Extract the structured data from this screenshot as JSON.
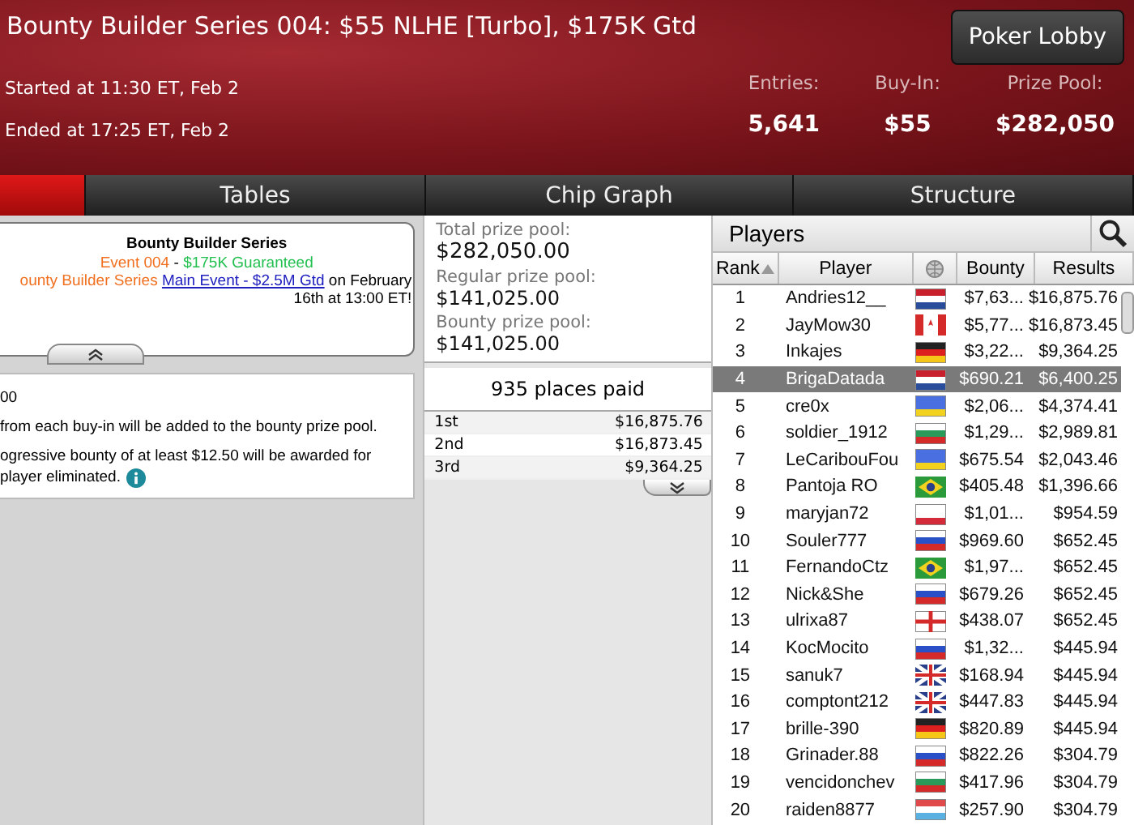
{
  "header": {
    "title": "Bounty Builder Series 004: $55 NLHE [Turbo], $175K Gtd",
    "lobby_button": "Poker Lobby",
    "started": "Started at 11:30 ET, Feb 2",
    "ended": "Ended at 17:25 ET, Feb 2",
    "stats": [
      {
        "label": "Entries:",
        "value": "5,641"
      },
      {
        "label": "Buy-In:",
        "value": "$55"
      },
      {
        "label": "Prize Pool:",
        "value": "$282,050"
      }
    ]
  },
  "tabs": [
    {
      "selected": true
    },
    {
      "label": "Tables",
      "selected": false
    },
    {
      "label": "Chip Graph",
      "selected": false
    },
    {
      "label": "Structure",
      "selected": false
    }
  ],
  "info_card": {
    "title": "Bounty Builder Series",
    "event": "Event 004",
    "dash": " - ",
    "guarantee": "$175K Guaranteed",
    "promo_prefix": "ounty Builder Series",
    "promo_link": "Main Event - $2.5M Gtd",
    "promo_suffix": " on February",
    "promo_line2": "16th at 13:00 ET!"
  },
  "details": [
    "00",
    "from each buy-in will be added to the bounty prize pool.",
    "ogressive bounty of at least $12.50 will be awarded for",
    "player eliminated."
  ],
  "prize_pools": [
    {
      "label": "Total prize pool:",
      "value": "$282,050.00"
    },
    {
      "label": "Regular prize pool:",
      "value": "$141,025.00"
    },
    {
      "label": "Bounty prize pool:",
      "value": "$141,025.00"
    }
  ],
  "places_paid": "935 places paid",
  "payouts": [
    {
      "place": "1st",
      "amount": "$16,875.76"
    },
    {
      "place": "2nd",
      "amount": "$16,873.45"
    },
    {
      "place": "3rd",
      "amount": "$9,364.25"
    }
  ],
  "players": {
    "title": "Players",
    "columns": [
      "Rank",
      "Player",
      "Bounty",
      "Results"
    ],
    "rows": [
      {
        "rank": "1",
        "name": "Andries12__",
        "kind": "nl",
        "bounty": "$7,63...",
        "result": "$16,875.76",
        "selected": false
      },
      {
        "rank": "2",
        "name": "JayMow30",
        "kind": "ca",
        "bounty": "$5,77...",
        "result": "$16,873.45",
        "selected": false
      },
      {
        "rank": "3",
        "name": "Inkajes",
        "kind": "de",
        "bounty": "$3,22...",
        "result": "$9,364.25",
        "selected": false
      },
      {
        "rank": "4",
        "name": "BrigaDatada",
        "kind": "nl",
        "bounty": "$690.21",
        "result": "$6,400.25",
        "selected": true
      },
      {
        "rank": "5",
        "name": "cre0x",
        "kind": "ua",
        "bounty": "$2,06...",
        "result": "$4,374.41",
        "selected": false
      },
      {
        "rank": "6",
        "name": "soldier_1912",
        "kind": "bg",
        "bounty": "$1,29...",
        "result": "$2,989.81",
        "selected": false
      },
      {
        "rank": "7",
        "name": "LeCaribouFou",
        "kind": "ua",
        "bounty": "$675.54",
        "result": "$2,043.46",
        "selected": false
      },
      {
        "rank": "8",
        "name": "Pantoja RO",
        "kind": "br",
        "bounty": "$405.48",
        "result": "$1,396.66",
        "selected": false
      },
      {
        "rank": "9",
        "name": "maryjan72",
        "kind": "pl",
        "bounty": "$1,01...",
        "result": "$954.59",
        "selected": false
      },
      {
        "rank": "10",
        "name": "Souler777",
        "kind": "ru",
        "bounty": "$969.60",
        "result": "$652.45",
        "selected": false
      },
      {
        "rank": "11",
        "name": "FernandoCtz",
        "kind": "br",
        "bounty": "$1,97...",
        "result": "$652.45",
        "selected": false
      },
      {
        "rank": "12",
        "name": "Nick&She",
        "kind": "ru",
        "bounty": "$679.26",
        "result": "$652.45",
        "selected": false
      },
      {
        "rank": "13",
        "name": "ulrixa87",
        "kind": "ge",
        "bounty": "$438.07",
        "result": "$652.45",
        "selected": false
      },
      {
        "rank": "14",
        "name": "KocMocito",
        "kind": "ru",
        "bounty": "$1,32...",
        "result": "$445.94",
        "selected": false
      },
      {
        "rank": "15",
        "name": "sanuk7",
        "kind": "gb",
        "bounty": "$168.94",
        "result": "$445.94",
        "selected": false
      },
      {
        "rank": "16",
        "name": "comptont212",
        "kind": "gb",
        "bounty": "$447.83",
        "result": "$445.94",
        "selected": false
      },
      {
        "rank": "17",
        "name": "brille-390",
        "kind": "de",
        "bounty": "$820.89",
        "result": "$445.94",
        "selected": false
      },
      {
        "rank": "18",
        "name": "Grinader.88",
        "kind": "ru",
        "bounty": "$822.26",
        "result": "$304.79",
        "selected": false
      },
      {
        "rank": "19",
        "name": "vencidonchev",
        "kind": "bg",
        "bounty": "$417.96",
        "result": "$304.79",
        "selected": false
      },
      {
        "rank": "20",
        "name": "raiden8877",
        "kind": "lu",
        "bounty": "$257.90",
        "result": "$304.79",
        "selected": false
      }
    ]
  }
}
